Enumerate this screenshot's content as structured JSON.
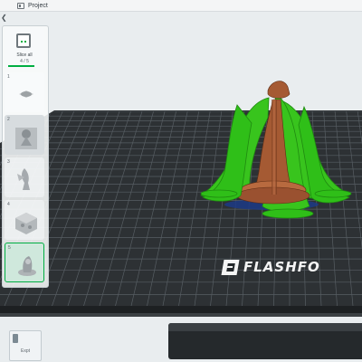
{
  "topbar": {
    "title": "Project",
    "icon": "project-icon"
  },
  "sidebar": {
    "collapse_icon": "chevron-left-icon",
    "slice_all": {
      "label": "Slice all",
      "count": "4 / 5",
      "progress": 0.8
    },
    "plates": [
      {
        "number": "1"
      },
      {
        "number": "2"
      },
      {
        "number": "3"
      },
      {
        "number": "4"
      },
      {
        "number": "5"
      }
    ]
  },
  "bed": {
    "brand": "FLASHFO"
  },
  "bottom_widget": {
    "label": "Expt"
  },
  "colors": {
    "accent": "#00ae42",
    "bed": "#2c3033",
    "grid": "#545b60",
    "model": "#a55a33",
    "support": "#33c21b"
  }
}
